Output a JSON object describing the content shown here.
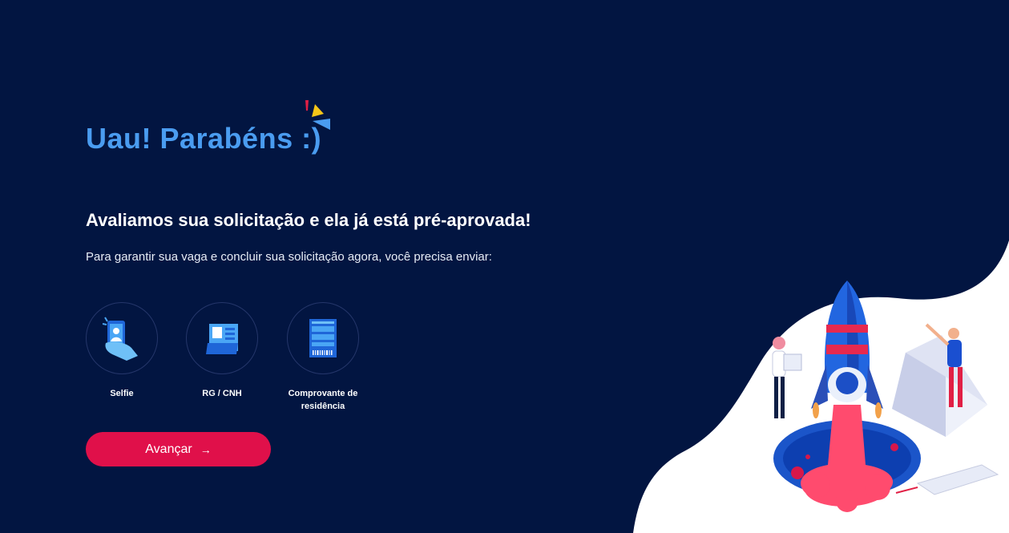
{
  "header": {
    "title": "Uau! Parabéns :)"
  },
  "main": {
    "subtitle": "Avaliamos sua solicitação e ela já está pré-aprovada!",
    "description": "Para garantir sua vaga e concluir sua solicitação agora, você precisa enviar:",
    "documents": [
      {
        "label": "Selfie",
        "icon": "selfie-hand-phone-icon"
      },
      {
        "label": "RG / CNH",
        "icon": "id-card-icon"
      },
      {
        "label_line1": "Comprovante de",
        "label_line2": "residência",
        "icon": "bill-document-icon"
      }
    ],
    "button": {
      "label": "Avançar",
      "icon": "arrow-right-icon"
    }
  },
  "colors": {
    "background": "#021541",
    "title_accent": "#4a9cf0",
    "button": "#e0104a",
    "illustration_bg": "#ffffff"
  },
  "illustration": {
    "icon": "rocket-launch-illustration"
  }
}
